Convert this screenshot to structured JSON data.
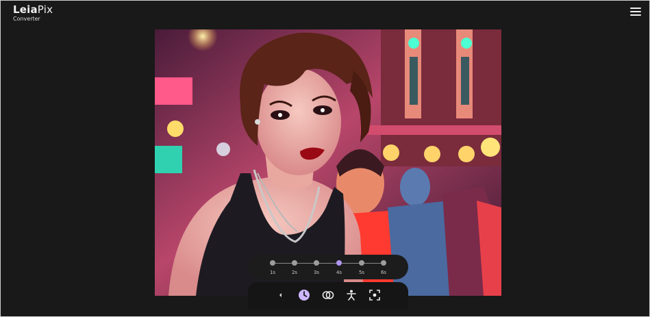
{
  "app": {
    "brand_bold": "Leia",
    "brand_light": "Pix",
    "subtitle": "Converter"
  },
  "header": {
    "menu_icon": "hamburger-menu-icon"
  },
  "image": {
    "description_alt": "Illustrated portrait of a woman with short dark hair in a black top at a neon-lit street"
  },
  "timeline": {
    "stops": [
      {
        "label": "1s",
        "active": false
      },
      {
        "label": "2s",
        "active": false
      },
      {
        "label": "3s",
        "active": false
      },
      {
        "label": "4s",
        "active": true
      },
      {
        "label": "5s",
        "active": false
      },
      {
        "label": "6s",
        "active": false
      }
    ],
    "active_color": "#b196f0"
  },
  "toolbar": {
    "items": [
      {
        "icon": "chevron-left-icon"
      },
      {
        "icon": "clock-icon",
        "selected": true
      },
      {
        "icon": "overlap-circles-icon"
      },
      {
        "icon": "motion-figure-icon"
      },
      {
        "icon": "focus-frame-icon"
      }
    ]
  }
}
